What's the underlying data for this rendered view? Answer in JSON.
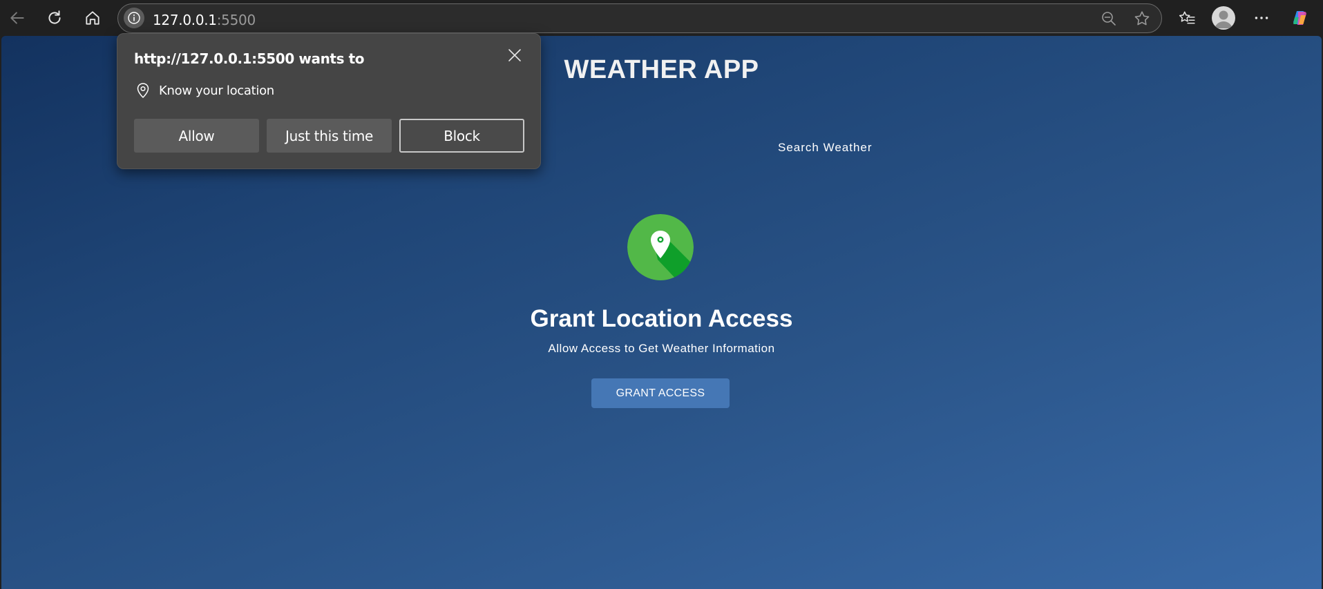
{
  "browser": {
    "url_host": "127.0.0.1",
    "url_port": ":5500",
    "icons": [
      "back-icon",
      "reload-icon",
      "home-icon",
      "site-info-icon",
      "zoom-out-icon",
      "favorite-star-icon",
      "favorites-icon",
      "profile-avatar",
      "more-icon",
      "copilot-icon"
    ]
  },
  "page": {
    "app_title": "WEATHER APP",
    "search_tab": "Search Weather",
    "grant_title": "Grant Location Access",
    "grant_subtitle": "Allow Access to Get Weather Information",
    "grant_button": "GRANT ACCESS",
    "location_icon_color": "#52b848",
    "button_color": "#4577b5"
  },
  "permission_popup": {
    "title": "http://127.0.0.1:5500 wants to",
    "permission": "Know your location",
    "buttons": {
      "allow": "Allow",
      "just_this_time": "Just this time",
      "block": "Block"
    }
  }
}
